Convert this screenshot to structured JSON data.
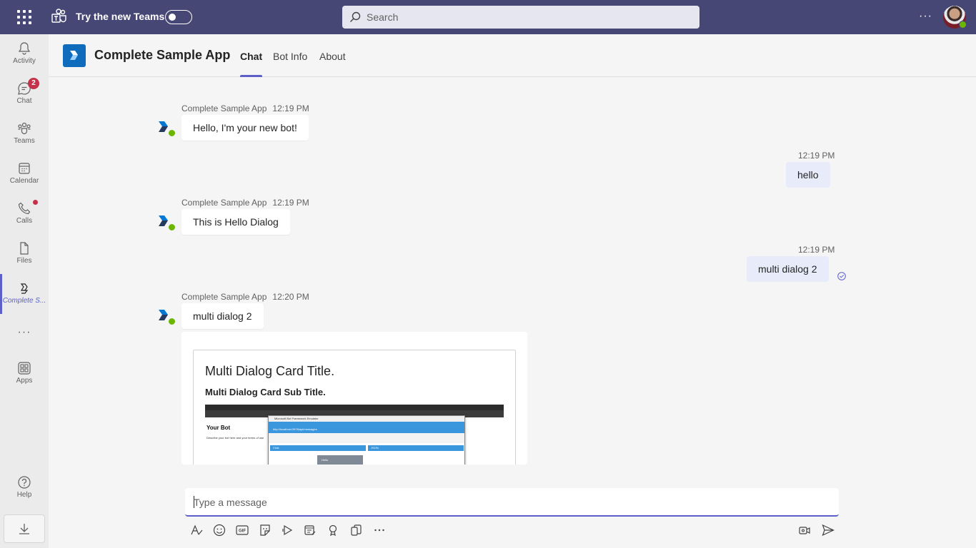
{
  "topbar": {
    "try_label": "Try the new Teams",
    "search_placeholder": "Search",
    "more_label": "···"
  },
  "rail": {
    "items": [
      {
        "label": "Activity",
        "icon": "bell-icon"
      },
      {
        "label": "Chat",
        "icon": "chat-icon",
        "badge": "2"
      },
      {
        "label": "Teams",
        "icon": "teams-icon"
      },
      {
        "label": "Calendar",
        "icon": "calendar-icon"
      },
      {
        "label": "Calls",
        "icon": "phone-icon"
      },
      {
        "label": "Files",
        "icon": "file-icon"
      },
      {
        "label": "Complete S...",
        "icon": "app-icon"
      },
      {
        "label": "Apps",
        "icon": "apps-icon"
      },
      {
        "label": "Help",
        "icon": "help-icon"
      }
    ],
    "more_label": "···"
  },
  "app": {
    "title": "Complete Sample App",
    "tabs": [
      "Chat",
      "Bot Info",
      "About"
    ]
  },
  "messages": [
    {
      "sender": "Complete Sample App",
      "time": "12:19 PM",
      "text": "Hello, I'm your new bot!"
    },
    {
      "time": "12:19 PM",
      "text": "hello"
    },
    {
      "sender": "Complete Sample App",
      "time": "12:19 PM",
      "text": "This is Hello Dialog"
    },
    {
      "time": "12:19 PM",
      "text": "multi dialog 2"
    },
    {
      "sender": "Complete Sample App",
      "time": "12:20 PM",
      "text": "multi dialog 2"
    }
  ],
  "card": {
    "title": "Multi Dialog Card Title.",
    "subtitle": "Multi Dialog Card Sub Title.",
    "image": {
      "page_heading": "Your Bot",
      "page_text": "Describe your bot here and your terms of use",
      "emulator_title": "Microsoft Bot Framework Emulator",
      "url": "http://localhost:3978/api/messages",
      "chat_label": "Chat",
      "json_label": "JSON",
      "bubble": "Hello"
    }
  },
  "compose": {
    "placeholder": "Type a message"
  }
}
